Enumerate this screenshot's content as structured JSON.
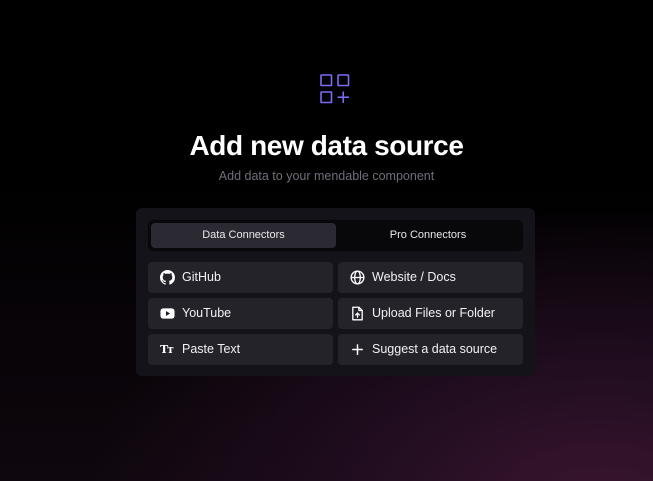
{
  "header": {
    "title": "Add new data source",
    "subtitle": "Add data to your mendable component",
    "icon": "add-widget-icon",
    "accent_color": "#7b6cf6"
  },
  "tabs": [
    {
      "label": "Data Connectors",
      "active": true
    },
    {
      "label": "Pro Connectors",
      "active": false
    }
  ],
  "options": [
    {
      "label": "GitHub",
      "icon": "github-icon"
    },
    {
      "label": "Website / Docs",
      "icon": "globe-icon"
    },
    {
      "label": "YouTube",
      "icon": "youtube-icon"
    },
    {
      "label": "Upload Files or Folder",
      "icon": "file-upload-icon"
    },
    {
      "label": "Paste Text",
      "icon": "text-icon",
      "glyph": "Tт"
    },
    {
      "label": "Suggest a data source",
      "icon": "plus-icon"
    }
  ]
}
